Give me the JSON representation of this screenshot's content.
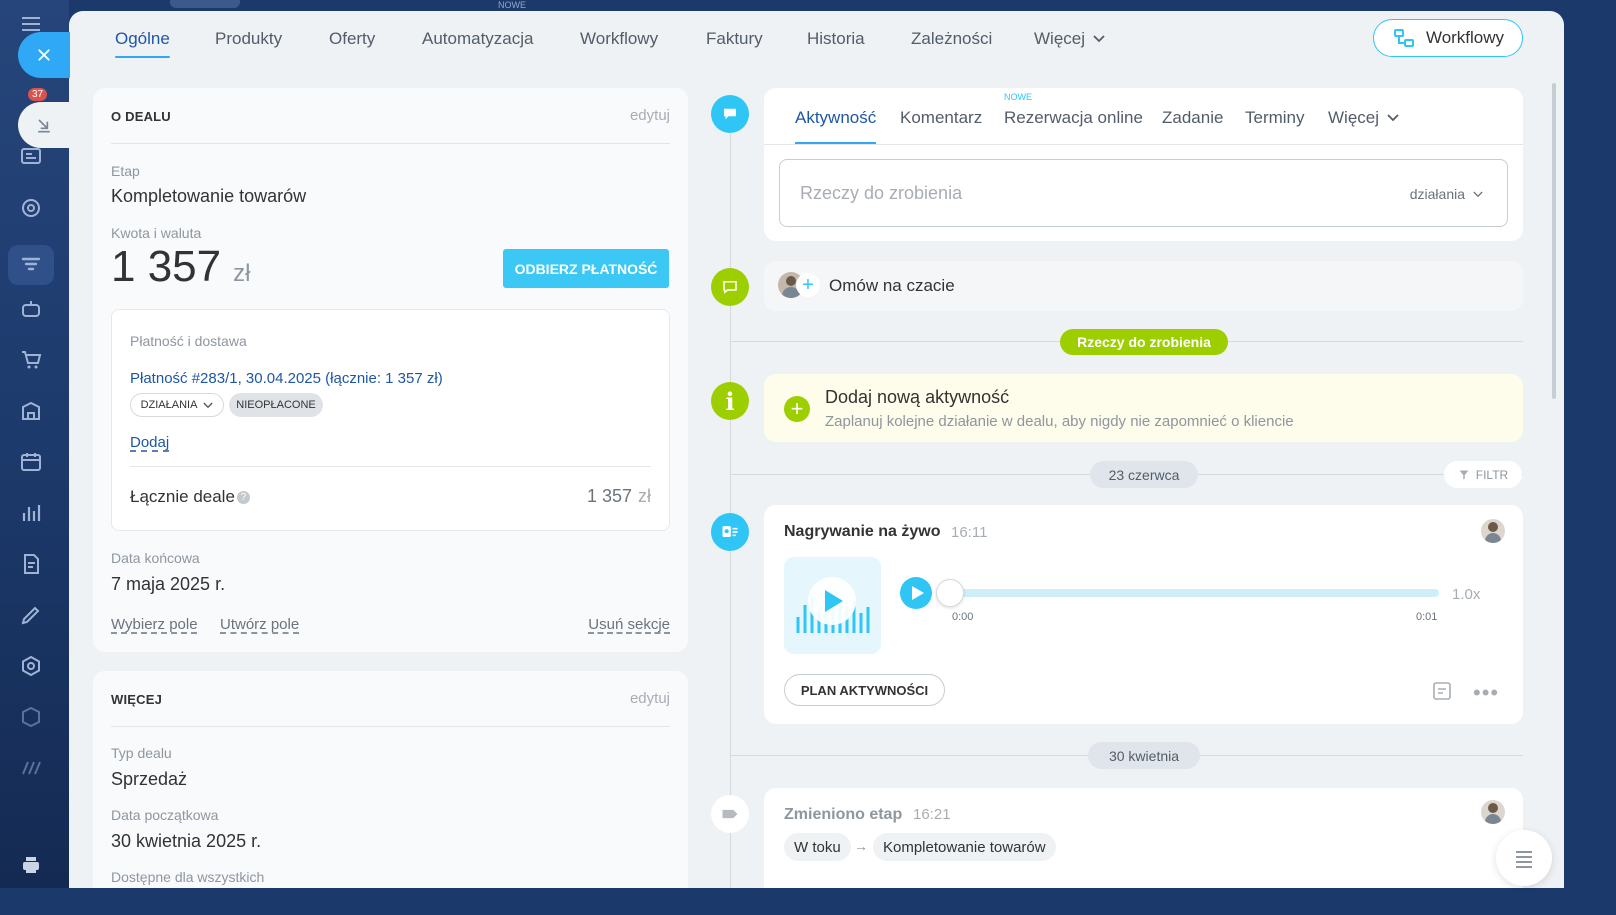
{
  "window": {
    "top_badge": "NOWE"
  },
  "sidebar": {
    "notifications_count": "37"
  },
  "topnav": {
    "tabs": [
      "Ogólne",
      "Produkty",
      "Oferty",
      "Automatyzacja",
      "Workflowy",
      "Faktury",
      "Historia",
      "Zależności",
      "Więcej"
    ],
    "workflow_button": "Workflowy"
  },
  "deal": {
    "title": "O DEALU",
    "edit": "edytuj",
    "stage_label": "Etap",
    "stage_value": "Kompletowanie towarów",
    "amount_label": "Kwota i waluta",
    "amount": "1 357",
    "currency": "zł",
    "receive_payment": "ODBIERZ PŁATNOŚĆ",
    "payment_section_label": "Płatność i dostawa",
    "payment_link": "Płatność #283/1, 30.04.2025 (łącznie: 1 357 zł)",
    "actions_pill": "DZIAŁANIA",
    "unpaid_pill": "NIEOPŁACONE",
    "add_link": "Dodaj",
    "total_label": "Łącznie deale",
    "total_value": "1 357",
    "total_currency": "zł",
    "end_date_label": "Data końcowa",
    "end_date": "7 maja 2025 r.",
    "choose_field": "Wybierz pole",
    "create_field": "Utwórz pole",
    "remove_section": "Usuń sekcje"
  },
  "more": {
    "title": "WIĘCEJ",
    "edit": "edytuj",
    "type_label": "Typ dealu",
    "type_value": "Sprzedaż",
    "start_label": "Data początkowa",
    "start_value": "30 kwietnia 2025 r.",
    "available_label": "Dostępne dla wszystkich"
  },
  "activity": {
    "tabs": [
      "Aktywność",
      "Komentarz",
      "Rezerwacja online",
      "Zadanie",
      "Terminy",
      "Więcej"
    ],
    "new_badge": "NOWE",
    "todo_placeholder": "Rzeczy do zrobienia",
    "actions_dropdown": "działania",
    "chat": "Omów na czacie",
    "todo_pill": "Rzeczy do zrobienia",
    "add_title": "Dodaj nową aktywność",
    "add_desc": "Zaplanuj kolejne działanie w dealu, aby nigdy nie zapomnieć o kliencie",
    "date1": "23 czerwca",
    "filter": "FILTR",
    "rec_title": "Nagrywanie na żywo",
    "rec_time": "16:11",
    "audio_start": "0:00",
    "audio_end": "0:01",
    "speed": "1.0x",
    "audio_progress": 0,
    "plan_button": "PLAN AKTYWNOŚCI",
    "date2": "30 kwietnia",
    "stage_change_title": "Zmieniono etap",
    "stage_change_time": "16:21",
    "stage_from": "W toku",
    "stage_to": "Kompletowanie towarów"
  },
  "colors": {
    "accent": "#2fc6f6",
    "link": "#1f57a5",
    "green": "#9dcf00",
    "timeline_blue": "#2fc6f6"
  }
}
